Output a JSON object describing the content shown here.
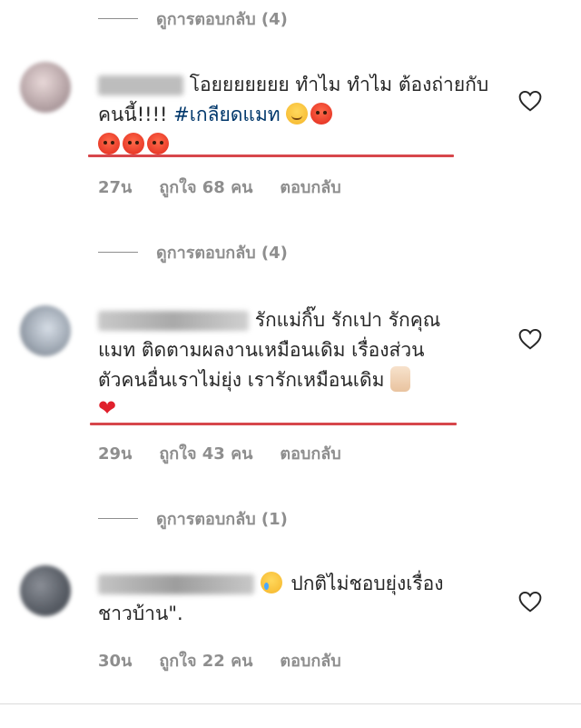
{
  "comments": [
    {
      "view_replies": "ดูการตอบกลับ (4)",
      "username_hidden": "",
      "text_pre": "โอยยยยยยย  ทำไม ทำไม ต้องถ่ายกับคนนี้!!!! ",
      "hashtag": "#เกลียดแมท",
      "emojis": [
        "smirk-icon",
        "angry-icon",
        "angry-icon",
        "angry-icon",
        "angry-icon"
      ],
      "time": "27น",
      "likes": "ถูกใจ 68 คน",
      "reply": "ตอบกลับ"
    },
    {
      "view_replies": "ดูการตอบกลับ (4)",
      "username_hidden": "",
      "text_line1": "รักแม่กิ๊บ รักเปา รักคุณ",
      "text_line2": "แมท ติดตามผลงานเหมือนเดิม เรื่องส่วน",
      "text_line3": "ตัวคนอื่นเราไม่ยุ่ง เรารักเหมือนเดิม",
      "emojis": [
        "victory-hand-icon",
        "red-heart-icon"
      ],
      "time": "29น",
      "likes": "ถูกใจ 43 คน",
      "reply": "ตอบกลับ"
    },
    {
      "view_replies": "ดูการตอบกลับ (1)",
      "username_hidden": "",
      "text_line1": "ปกติไม่ชอบยุ่งเรื่อง",
      "text_line2": "ชาวบ้าน\".",
      "emojis": [
        "crying-face-icon"
      ],
      "time": "30น",
      "likes": "ถูกใจ 22 คน",
      "reply": "ตอบกลับ"
    }
  ],
  "colors": {
    "text": "#262626",
    "meta": "#8e8e8e",
    "hashtag": "#00376b",
    "underline": "#d7464b"
  }
}
